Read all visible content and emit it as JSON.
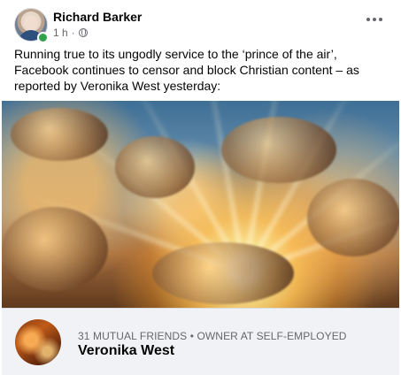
{
  "post": {
    "author": "Richard Barker",
    "time": "1 h",
    "separator": "·",
    "text": "Running true to its ungodly service to the ‘prince of the air’, Facebook continues to censor and block Christian content – as reported by Veronika West yesterday:"
  },
  "preview": {
    "meta": "31 MUTUAL FRIENDS • OWNER AT SELF-EMPLOYED",
    "name": "Veronika West"
  },
  "icons": {
    "more": "more-icon",
    "privacy": "globe-icon",
    "status": "online-status-icon"
  },
  "colors": {
    "online": "#31a24c",
    "text": "#050505",
    "secondary": "#65676b",
    "preview_bg": "#f0f2f5"
  }
}
